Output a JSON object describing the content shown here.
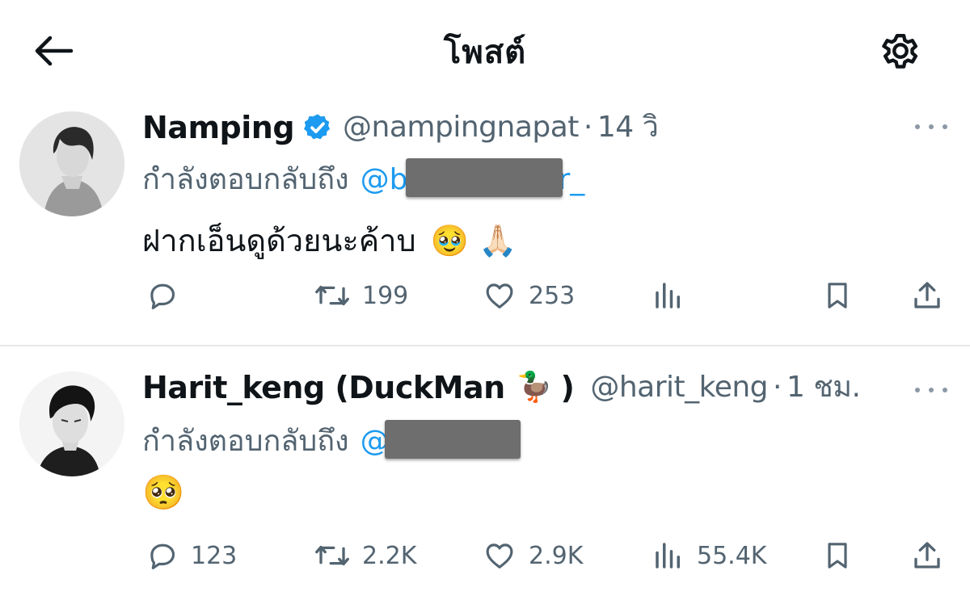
{
  "header": {
    "title": "โพสต์",
    "back_icon": "arrow-left-icon",
    "settings_icon": "gear-icon"
  },
  "posts": [
    {
      "display_name": "Namping",
      "verified": true,
      "handle": "@nampingnapat",
      "dot": "·",
      "time": "14 วิ",
      "reply_label": "กำลังตอบกลับถึง",
      "reply_handle_visible": "@b",
      "reply_handle_tail": "r_",
      "text": "ฝากเอ็นดูด้วยนะค้าบ",
      "emojis": "🥹 🙏🏻",
      "actions": {
        "replies": "",
        "reposts": "199",
        "likes": "253",
        "views": ""
      }
    },
    {
      "display_name": "Harit_keng (DuckMan",
      "name_emoji": "🦆",
      "name_close": ")",
      "verified": false,
      "handle": "@harit_keng",
      "dot": "·",
      "time": "1 ชม.",
      "reply_label": "กำลังตอบกลับถึง",
      "reply_handle_visible": "@",
      "text": "🥺",
      "actions": {
        "replies": "123",
        "reposts": "2.2K",
        "likes": "2.9K",
        "views": "55.4K"
      }
    }
  ],
  "colors": {
    "text": "#0f1419",
    "secondary": "#536471",
    "link": "#1d9bf0",
    "verified": "#1d9bf0",
    "divider": "#e6e8ea",
    "redaction": "#6e6e6e"
  }
}
